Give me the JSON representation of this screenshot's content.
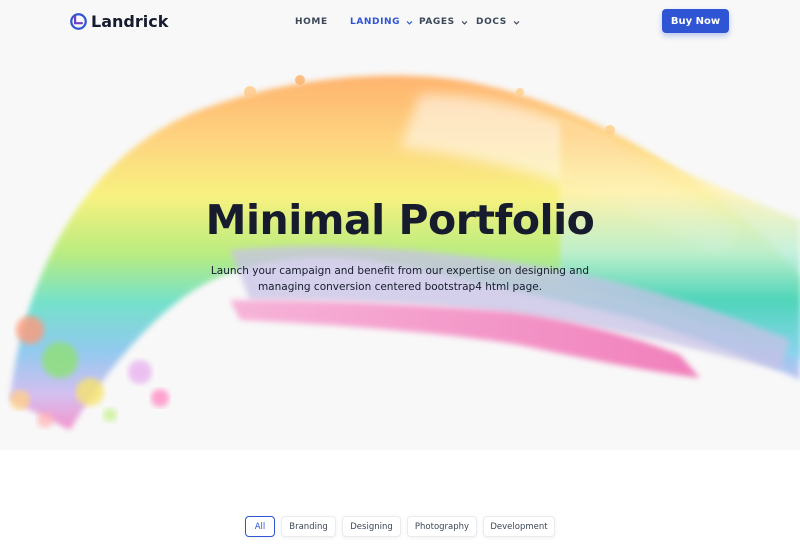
{
  "header": {
    "logo_text": "Landrick",
    "logo_icon": "landrick-logo-icon",
    "nav": [
      {
        "label": "HOME",
        "dropdown": false,
        "active": false
      },
      {
        "label": "LANDING",
        "dropdown": true,
        "active": true
      },
      {
        "label": "PAGES",
        "dropdown": true,
        "active": false
      },
      {
        "label": "DOCS",
        "dropdown": true,
        "active": false
      }
    ],
    "cta_label": "Buy Now"
  },
  "hero": {
    "title": "Minimal Portfolio",
    "description_line1": "Launch your campaign and benefit from our expertise on designing and",
    "description_line2": "managing conversion centered bootstrap4 html page."
  },
  "portfolio_filters": {
    "items": [
      "All",
      "Branding",
      "Designing",
      "Photography",
      "Development"
    ],
    "active": "All"
  },
  "colors": {
    "primary": "#2f55d4",
    "heading": "#161c2d",
    "nav_text": "#3c4858"
  }
}
